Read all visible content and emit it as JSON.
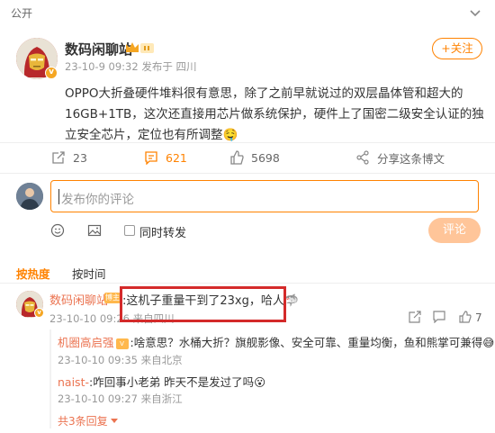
{
  "topbar": {
    "visibility": "公开"
  },
  "post": {
    "author": "数码闲聊站",
    "meta": "23-10-9 09:32 发布于 四川",
    "follow_label": "+关注",
    "text": "OPPO大折叠硬件堆料很有意思，除了之前早就说过的双层晶体管和超大的16GB+1TB，这次还直接用芯片做系统保护，硬件上了国密二级安全认证的独立安全芯片，定位也有所调整🤤"
  },
  "actions": {
    "repost_count": "23",
    "comment_count": "621",
    "like_count": "5698",
    "share_label": "分享这条博文"
  },
  "compose": {
    "placeholder": "发布你的评论",
    "also_repost_label": "同时转发",
    "submit_label": "评论"
  },
  "sort_tabs": [
    {
      "label": "按热度",
      "active": true
    },
    {
      "label": "按时间",
      "active": false
    }
  ],
  "comment": {
    "author": "数码闲聊站",
    "badge": "博主",
    "text": ":这机子重量干到了23xg，哈人🦈",
    "meta": "23-10-10 09:26 来自四川",
    "like_count": "7"
  },
  "replies": [
    {
      "author": "机圈高启强",
      "badge": "V",
      "text": ":啥意思？水桶大折？旗舰影像、安全可靠、重量均衡，鱼和熊掌可兼得😅",
      "meta": "23-10-10 09:35 来自北京"
    },
    {
      "author": "naist-",
      "badge": "",
      "text": ":咋回事小老弟 昨天不是发过了吗😮",
      "meta": "23-10-10 09:27 来自浙江"
    }
  ],
  "more_replies": "共3条回复",
  "colors": {
    "accent": "#ff8200",
    "name": "#eb7350",
    "highlight": "#d42a2a"
  },
  "icons": [
    "chevron-down-icon",
    "repost-icon",
    "comment-icon",
    "like-icon",
    "share-icon",
    "emoji-icon",
    "image-icon",
    "flag-icon",
    "reply-icon"
  ]
}
